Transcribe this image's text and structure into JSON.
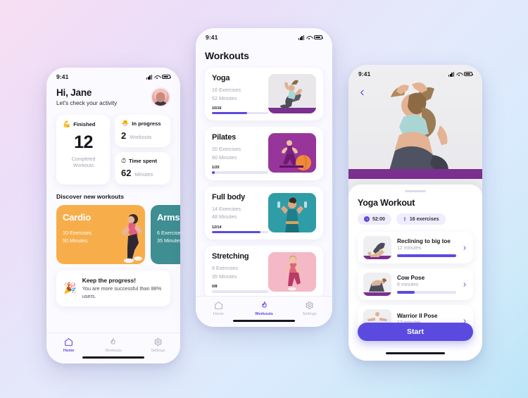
{
  "theme": {
    "accent": "#5b4ae0",
    "cardio_bg": "#f7ae4a",
    "arms_bg": "#3e8e92",
    "pilates_bg": "#97359b",
    "fullbody_bg": "#2f9da8",
    "stretching_bg": "#f4b8c6",
    "yoga_bg": "#e9e7ea",
    "bg_top_left": "#f6dff2",
    "bg_top_right": "#deebfd",
    "bg_bottom_left": "#e2e1fb",
    "bg_bottom_right": "#b9e4f7"
  },
  "home": {
    "status": {
      "time": "9:41",
      "signal_icon": "cellular-signal-icon",
      "wifi_icon": "wifi-icon",
      "battery_icon": "battery-icon"
    },
    "greeting": "Hi, Jane",
    "subgreeting": "Let's check your activity",
    "avatar_name": "user-avatar",
    "stats": {
      "finished": {
        "icon": "💪",
        "icon_name": "flexed-biceps-icon",
        "label": "Finished",
        "value": "12",
        "caption": "Completed\nWorkouts"
      },
      "in_progress": {
        "icon": "🐣",
        "icon_name": "hatching-chick-icon",
        "label": "In progress",
        "value": "2",
        "unit": "Workouts"
      },
      "time_spent": {
        "icon": "⏱",
        "icon_name": "stopwatch-icon",
        "label": "Time spent",
        "value": "62",
        "unit": "Minutes"
      }
    },
    "discover_title": "Discover new workouts",
    "discover": [
      {
        "name": "Cardio",
        "exercises": "10 Exercises",
        "minutes": "50 Minutes",
        "color": "#f7ae4a"
      },
      {
        "name": "Arms",
        "exercises": "6 Exercises",
        "minutes": "35 Minutes",
        "color": "#3e8e92"
      }
    ],
    "progress_banner": {
      "icon": "🎉",
      "icon_name": "party-popper-icon",
      "title": "Keep the progress!",
      "text": "You are more successful than 88% users."
    },
    "tabs": [
      {
        "label": "Home",
        "icon": "home-icon",
        "active": true
      },
      {
        "label": "Workouts",
        "icon": "flame-icon",
        "active": false
      },
      {
        "label": "Settings",
        "icon": "gear-icon",
        "active": false
      }
    ]
  },
  "workouts": {
    "status": {
      "time": "9:41"
    },
    "title": "Workouts",
    "items": [
      {
        "name": "Yoga",
        "exercises": "16 Exercises",
        "minutes": "52 Minutes",
        "progress_label": "10/16",
        "progress_pct": 62,
        "thumb": "yoga-thumb"
      },
      {
        "name": "Pilates",
        "exercises": "20 Exercises",
        "minutes": "60 Minutes",
        "progress_label": "1/20",
        "progress_pct": 5,
        "thumb": "pilates-thumb"
      },
      {
        "name": "Full body",
        "exercises": "14 Exercises",
        "minutes": "48 Minutes",
        "progress_label": "12/14",
        "progress_pct": 86,
        "thumb": "fullbody-thumb"
      },
      {
        "name": "Stretching",
        "exercises": "8 Exercises",
        "minutes": "35 Minutes",
        "progress_label": "0/8",
        "progress_pct": 0,
        "thumb": "stretching-thumb"
      }
    ],
    "tabs": [
      {
        "label": "Home",
        "icon": "home-icon",
        "active": false
      },
      {
        "label": "Workouts",
        "icon": "flame-icon",
        "active": true
      },
      {
        "label": "Settings",
        "icon": "gear-icon",
        "active": false
      }
    ]
  },
  "detail": {
    "status": {
      "time": "9:41"
    },
    "back_icon": "chevron-left-icon",
    "title": "Yoga Workout",
    "chips": [
      {
        "icon": "clock-icon",
        "label": "52:00"
      },
      {
        "icon": "person-icon",
        "label": "16 exercises"
      }
    ],
    "exercises": [
      {
        "name": "Reclining to big toe",
        "duration": "12 minutes",
        "progress_pct": 100,
        "chevron": "chevron-right-icon"
      },
      {
        "name": "Cow Pose",
        "duration": "8 minutes",
        "progress_pct": 30,
        "chevron": "chevron-right-icon"
      },
      {
        "name": "Warrior II Pose",
        "duration": "12 minutes",
        "progress_pct": 0,
        "chevron": "chevron-right-icon"
      }
    ],
    "start_label": "Start"
  }
}
